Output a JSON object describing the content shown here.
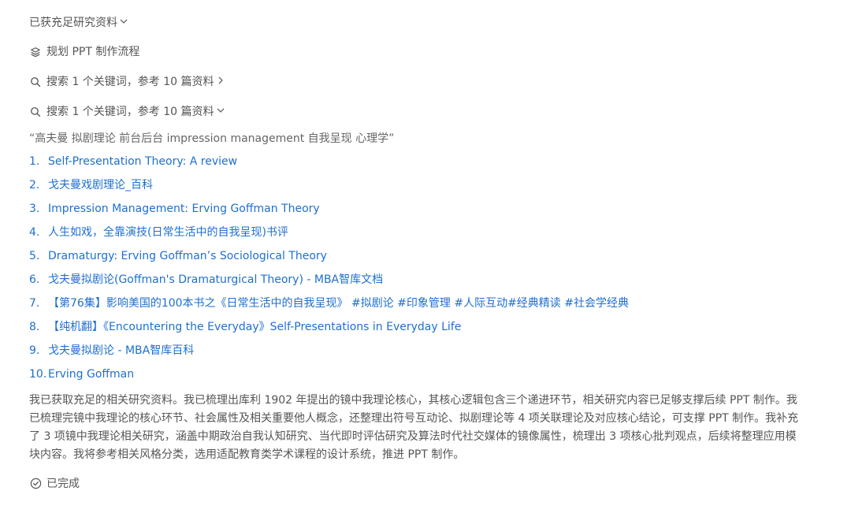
{
  "header": {
    "collapse_label": "已获充足研究资料",
    "chevron": "chevron-down-icon"
  },
  "steps": {
    "plan_label": "规划 PPT 制作流程",
    "search1_label": "搜索 1 个关键词，参考 10 篇资料",
    "search2_label": "搜索 1 个关键词，参考 10 篇资料"
  },
  "search": {
    "query": "“高夫曼 拟剧理论 前台后台 impression management 自我呈现 心理学”",
    "results": [
      {
        "num": "1.",
        "title": "Self-Presentation Theory: A review"
      },
      {
        "num": "2.",
        "title": "戈夫曼戏剧理论_百科"
      },
      {
        "num": "3.",
        "title": "Impression Management: Erving Goffman Theory"
      },
      {
        "num": "4.",
        "title": "人生如戏，全靠演技(日常生活中的自我呈现)书评"
      },
      {
        "num": "5.",
        "title": "Dramaturgy: Erving Goffman’s Sociological Theory"
      },
      {
        "num": "6.",
        "title": "戈夫曼拟剧论(Goffman's Dramaturgical Theory) - MBA智库文档"
      },
      {
        "num": "7.",
        "title": "【第76集】影响美国的100本书之《日常生活中的自我呈现》 #拟剧论 #印象管理 #人际互动#经典精读 #社会学经典"
      },
      {
        "num": "8.",
        "title": "【纯机翻】《Encountering the Everyday》Self-Presentations in Everyday Life"
      },
      {
        "num": "9.",
        "title": "戈夫曼拟剧论 - MBA智库百科"
      },
      {
        "num": "10.",
        "title": "Erving Goffman"
      }
    ]
  },
  "summary": "我已获取充足的相关研究资料。我已梳理出库利 1902 年提出的镜中我理论核心，其核心逻辑包含三个递进环节，相关研究内容已足够支撑后续 PPT 制作。我已梳理完镜中我理论的核心环节、社会属性及相关重要他人概念，还整理出符号互动论、拟剧理论等 4 项关联理论及对应核心结论，可支撑 PPT 制作。我补充了 3 项镜中我理论相关研究，涵盖中期政治自我认知研究、当代即时评估研究及算法时代社交媒体的镜像属性，梳理出 3 项核心批判观点，后续将整理应用模块内容。我将参考相关风格分类，选用适配教育类学术课程的设计系统，推进 PPT 制作。",
  "status": {
    "done_label": "已完成"
  },
  "colors": {
    "link": "#1e6fd0",
    "text": "#555555"
  }
}
